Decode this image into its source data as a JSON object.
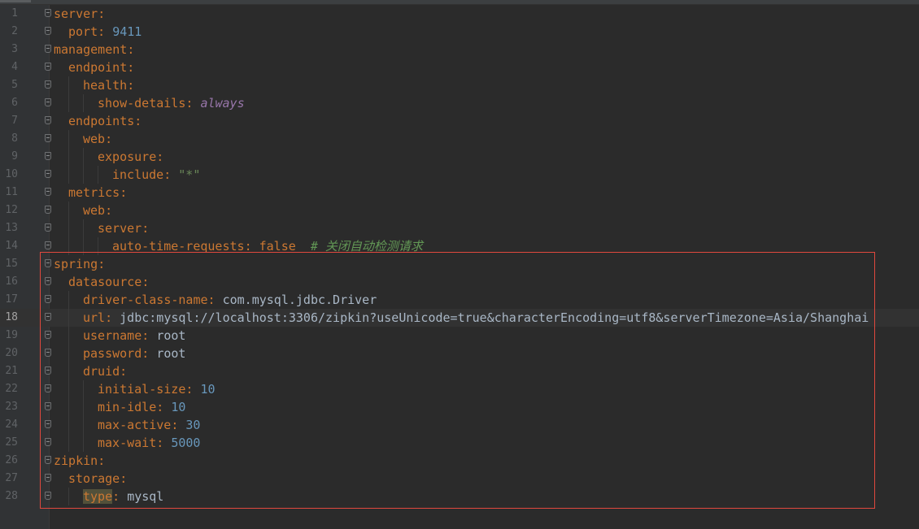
{
  "editor": {
    "current_line": 18,
    "lines": [
      {
        "n": "1",
        "indent": 0,
        "key": "server",
        "sep": ":",
        "value": "",
        "vtype": "",
        "comment": ""
      },
      {
        "n": "2",
        "indent": 1,
        "key": "port",
        "sep": ": ",
        "value": "9411",
        "vtype": "num",
        "comment": ""
      },
      {
        "n": "3",
        "indent": 0,
        "key": "management",
        "sep": ":",
        "value": "",
        "vtype": "",
        "comment": ""
      },
      {
        "n": "4",
        "indent": 1,
        "key": "endpoint",
        "sep": ":",
        "value": "",
        "vtype": "",
        "comment": ""
      },
      {
        "n": "5",
        "indent": 2,
        "key": "health",
        "sep": ":",
        "value": "",
        "vtype": "",
        "comment": ""
      },
      {
        "n": "6",
        "indent": 3,
        "key": "show-details",
        "sep": ": ",
        "value": "always",
        "vtype": "kw-italic",
        "comment": ""
      },
      {
        "n": "7",
        "indent": 1,
        "key": "endpoints",
        "sep": ":",
        "value": "",
        "vtype": "",
        "comment": ""
      },
      {
        "n": "8",
        "indent": 2,
        "key": "web",
        "sep": ":",
        "value": "",
        "vtype": "",
        "comment": ""
      },
      {
        "n": "9",
        "indent": 3,
        "key": "exposure",
        "sep": ":",
        "value": "",
        "vtype": "",
        "comment": ""
      },
      {
        "n": "10",
        "indent": 4,
        "key": "include",
        "sep": ": ",
        "value": "\"*\"",
        "vtype": "str",
        "comment": ""
      },
      {
        "n": "11",
        "indent": 1,
        "key": "metrics",
        "sep": ":",
        "value": "",
        "vtype": "",
        "comment": ""
      },
      {
        "n": "12",
        "indent": 2,
        "key": "web",
        "sep": ":",
        "value": "",
        "vtype": "",
        "comment": ""
      },
      {
        "n": "13",
        "indent": 3,
        "key": "server",
        "sep": ":",
        "value": "",
        "vtype": "",
        "comment": ""
      },
      {
        "n": "14",
        "indent": 4,
        "key": "auto-time-requests",
        "sep": ": ",
        "value": "false",
        "vtype": "kw",
        "comment": "  # 关闭自动检测请求"
      },
      {
        "n": "15",
        "indent": 0,
        "key": "spring",
        "sep": ":",
        "value": "",
        "vtype": "",
        "comment": ""
      },
      {
        "n": "16",
        "indent": 1,
        "key": "datasource",
        "sep": ":",
        "value": "",
        "vtype": "",
        "comment": ""
      },
      {
        "n": "17",
        "indent": 2,
        "key": "driver-class-name",
        "sep": ": ",
        "value": "com.mysql.jdbc.Driver",
        "vtype": "plain",
        "comment": ""
      },
      {
        "n": "18",
        "indent": 2,
        "key": "url",
        "sep": ": ",
        "value": "jdbc:mysql://localhost:3306/zipkin?useUnicode=true&characterEncoding=utf8&serverTimezone=Asia/Shanghai",
        "vtype": "plain",
        "comment": ""
      },
      {
        "n": "19",
        "indent": 2,
        "key": "username",
        "sep": ": ",
        "value": "root",
        "vtype": "plain",
        "comment": ""
      },
      {
        "n": "20",
        "indent": 2,
        "key": "password",
        "sep": ": ",
        "value": "root",
        "vtype": "plain",
        "comment": ""
      },
      {
        "n": "21",
        "indent": 2,
        "key": "druid",
        "sep": ":",
        "value": "",
        "vtype": "",
        "comment": ""
      },
      {
        "n": "22",
        "indent": 3,
        "key": "initial-size",
        "sep": ": ",
        "value": "10",
        "vtype": "num",
        "comment": ""
      },
      {
        "n": "23",
        "indent": 3,
        "key": "min-idle",
        "sep": ": ",
        "value": "10",
        "vtype": "num",
        "comment": ""
      },
      {
        "n": "24",
        "indent": 3,
        "key": "max-active",
        "sep": ": ",
        "value": "30",
        "vtype": "num",
        "comment": ""
      },
      {
        "n": "25",
        "indent": 3,
        "key": "max-wait",
        "sep": ": ",
        "value": "5000",
        "vtype": "num",
        "comment": ""
      },
      {
        "n": "26",
        "indent": 0,
        "key": "zipkin",
        "sep": ":",
        "value": "",
        "vtype": "",
        "comment": ""
      },
      {
        "n": "27",
        "indent": 1,
        "key": "storage",
        "sep": ":",
        "value": "",
        "vtype": "",
        "comment": ""
      },
      {
        "n": "28",
        "indent": 2,
        "key": "type",
        "sep": ": ",
        "value": "mysql",
        "vtype": "plain",
        "comment": "",
        "highlight_key": true
      }
    ]
  },
  "annotation": {
    "color": "#e0483e"
  },
  "colors": {
    "background": "#2b2b2b",
    "gutter": "#313335",
    "key": "#cc7832",
    "number": "#6897bb",
    "string": "#6a8759",
    "comment": "#629755"
  }
}
